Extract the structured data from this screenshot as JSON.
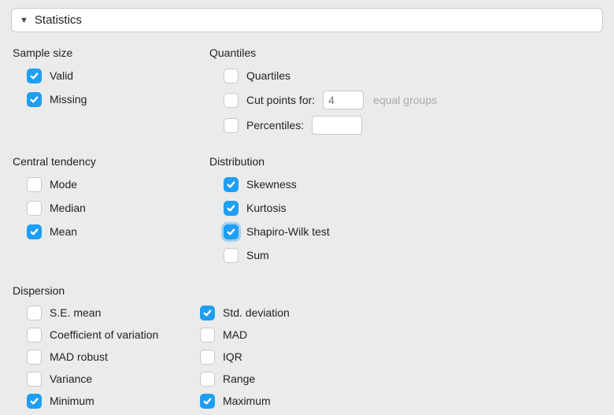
{
  "header": {
    "title": "Statistics"
  },
  "groups": {
    "sampleSize": {
      "title": "Sample size",
      "valid": "Valid",
      "missing": "Missing"
    },
    "quantiles": {
      "title": "Quantiles",
      "quartiles": "Quartiles",
      "cutPointsFor": "Cut points for:",
      "cutPointsValue": "4",
      "equalGroups": "equal groups",
      "percentiles": "Percentiles:",
      "percentilesValue": ""
    },
    "centralTendency": {
      "title": "Central tendency",
      "mode": "Mode",
      "median": "Median",
      "mean": "Mean"
    },
    "distribution": {
      "title": "Distribution",
      "skewness": "Skewness",
      "kurtosis": "Kurtosis",
      "shapiroWilk": "Shapiro-Wilk test",
      "sum": "Sum"
    },
    "dispersion": {
      "title": "Dispersion",
      "seMean": "S.E. mean",
      "stdDev": "Std. deviation",
      "cov": "Coefficient of variation",
      "mad": "MAD",
      "madRobust": "MAD robust",
      "iqr": "IQR",
      "variance": "Variance",
      "range": "Range",
      "minimum": "Minimum",
      "maximum": "Maximum"
    }
  },
  "state": {
    "valid": true,
    "missing": true,
    "quartiles": false,
    "cutPoints": false,
    "percentiles": false,
    "mode": false,
    "median": false,
    "mean": true,
    "skewness": true,
    "kurtosis": true,
    "shapiroWilk": true,
    "sum": false,
    "seMean": false,
    "stdDev": true,
    "cov": false,
    "mad": false,
    "madRobust": false,
    "iqr": false,
    "variance": false,
    "range": false,
    "minimum": true,
    "maximum": true
  }
}
